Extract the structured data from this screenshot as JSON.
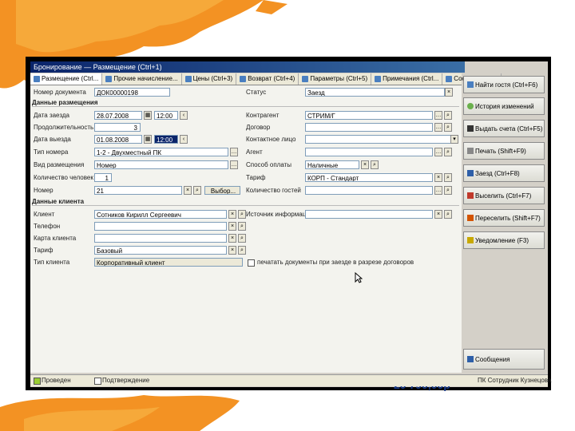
{
  "window": {
    "title": "Бронирование — Размещение (Ctrl+1)"
  },
  "tabs": [
    {
      "label": "Размещение (Ctrl..."
    },
    {
      "label": "Прочие начисление..."
    },
    {
      "label": "Цены (Ctrl+3)"
    },
    {
      "label": "Возврат (Ctrl+4)"
    },
    {
      "label": "Параметры (Ctrl+5)"
    },
    {
      "label": "Примечания (Ctrl..."
    },
    {
      "label": "Состав группы"
    }
  ],
  "form": {
    "doc_number": {
      "label": "Номер документа",
      "value": "ДОК00000198"
    },
    "status": {
      "label": "Статус",
      "value": "Заезд"
    },
    "section_accommodation": "Данные размещения",
    "arrival_date": {
      "label": "Дата заезда",
      "value": "28.07.2008",
      "time": "12:00"
    },
    "duration": {
      "label": "Продолжительность",
      "value": "3"
    },
    "departure_date": {
      "label": "Дата выезда",
      "value": "01.08.2008",
      "time": "12:00"
    },
    "room_type": {
      "label": "Тип номера",
      "value": "1-2 - Двухместный ПК"
    },
    "accommodation_type": {
      "label": "Вид размещения",
      "value": "Номер"
    },
    "guests_count": {
      "label": "Количество человек",
      "value": "1"
    },
    "room": {
      "label": "Номер",
      "value": "21",
      "select_button": "Выбор..."
    },
    "contractor": {
      "label": "Контрагент",
      "value": "СТРИМ/Г"
    },
    "contract": {
      "label": "Договор",
      "value": ""
    },
    "contact_person": {
      "label": "Контактное лицо",
      "value": ""
    },
    "agent": {
      "label": "Агент",
      "value": ""
    },
    "payment_method": {
      "label": "Способ оплаты",
      "value": "Наличные"
    },
    "rate": {
      "label": "Тариф",
      "value": "КОРП - Стандарт"
    },
    "guests_group": {
      "label": "Количество гостей",
      "value": ""
    },
    "section_client": "Данные клиента",
    "client": {
      "label": "Клиент",
      "value": "Сотников Кирилл Сергеевич"
    },
    "client_phone": {
      "label": "Телефон",
      "value": ""
    },
    "client_card": {
      "label": "Карта клиента",
      "value": ""
    },
    "client_tariff": {
      "label": "Тариф",
      "value": "Базовый"
    },
    "client_type": {
      "label": "Тип клиента",
      "value": "Корпоративный клиент"
    },
    "info_source": {
      "label": "Источник информации",
      "value": ""
    },
    "print_checkbox_label": "печатать документы при заезде в разрезе договоров"
  },
  "side": {
    "buttons": [
      {
        "label": "Найти гостя (Ctrl+F6)"
      },
      {
        "label": "История изменений"
      },
      {
        "label": "Выдать счета (Ctrl+F5)"
      },
      {
        "label": "Печать (Shift+F9)"
      },
      {
        "label": "Заезд (Ctrl+F8)"
      },
      {
        "label": "Выселить (Ctrl+F7)"
      },
      {
        "label": "Переселить (Shift+F7)"
      },
      {
        "label": "Уведомление (F3)"
      }
    ],
    "messages_button": "Сообщения"
  },
  "total": "20 790,00р",
  "status": {
    "left_check": "Проведен",
    "middle_check": "Подтверждение",
    "right_info": "ПК  Сотрудник  Кузнецова"
  },
  "colors": {
    "accent": "#1a3d8f",
    "splash": "#f28a1e"
  }
}
